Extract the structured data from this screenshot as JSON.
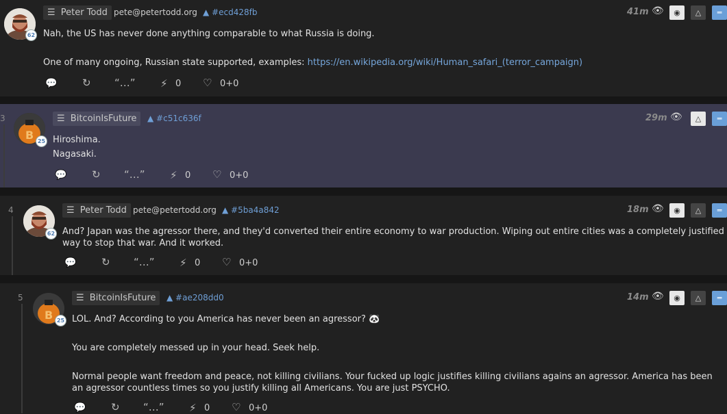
{
  "posts": [
    {
      "num": "",
      "author": "Peter Todd",
      "nip05": "pete@petertodd.org",
      "level": "62",
      "hash": "▲ #ecd428fb",
      "time": "41m",
      "lines": [
        "Nah, the US has never done anything comparable to what Russia is doing.",
        "One of many ongoing, Russian state supported, examples: "
      ],
      "link": "https://en.wikipedia.org/wiki/Human_safari_(terror_campaign)",
      "zaps": "0",
      "likes": "0+0"
    },
    {
      "num": "3",
      "author": "BitcoinIsFuture",
      "level": "25",
      "hash": "▲ #c51c636f",
      "time": "29m",
      "lines": [
        "Hiroshima.",
        "Nagasaki."
      ],
      "zaps": "0",
      "likes": "0+0"
    },
    {
      "num": "4",
      "author": "Peter Todd",
      "nip05": "pete@petertodd.org",
      "level": "62",
      "hash": "▲ #5ba4a842",
      "time": "18m",
      "lines": [
        "And? Japan was the agressor there, and they'd converted their entire economy to war production. Wiping out entire cities was a completely justified",
        "way to stop that war. And it worked."
      ],
      "zaps": "0",
      "likes": "0+0"
    },
    {
      "num": "5",
      "author": "BitcoinIsFuture",
      "level": "25",
      "hash": "▲ #ae208dd0",
      "time": "14m",
      "lines": [
        "LOL. And? According to you America has never been an agressor? 🐼",
        "You are completely messed up in your head. Seek help.",
        "Normal people want freedom and peace, not killing civilians. Your fucked up logic justifies killing civilians agains an agressor. America has been",
        "an agressor countless times so you justify killing all Americans. You are just PSYCHO."
      ],
      "zaps": "0",
      "likes": "0+0"
    }
  ],
  "ui": {
    "menu_glyph": "☰",
    "eye_glyph": "👁",
    "quote_glyph": "“…”",
    "bolt_glyph": "⚡",
    "heart_glyph": "♡",
    "reply_glyph": "💬",
    "repost_glyph": "↻",
    "dot_glyph": "◉",
    "up_glyph": "△",
    "equal_glyph": "═"
  },
  "colors": {
    "accent": "#6a9fd8",
    "highlight_bg": "#3b3a4f",
    "hash": "#6f9fd6",
    "link": "#76a7dc"
  }
}
